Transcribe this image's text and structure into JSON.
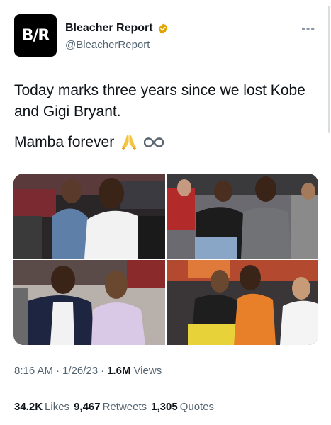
{
  "author": {
    "avatar_text": "B/R",
    "name": "Bleacher Report",
    "handle": "@BleacherReport",
    "verified_color": "#f4b400"
  },
  "menu_icon": "more-horizontal-icon",
  "tweet": {
    "line1": "Today marks three years since we lost Kobe and Gigi Bryant.",
    "line2": "Mamba forever",
    "emojis": [
      "folded-hands-icon",
      "infinity-icon"
    ]
  },
  "media": {
    "photos": [
      {
        "subject": "photo-1"
      },
      {
        "subject": "photo-2"
      },
      {
        "subject": "photo-3"
      },
      {
        "subject": "photo-4"
      }
    ]
  },
  "meta": {
    "time": "8:16 AM",
    "date": "1/26/23",
    "views_count": "1.6M",
    "views_label": "Views",
    "separator": "·"
  },
  "stats": {
    "likes_count": "34.2K",
    "likes_label": "Likes",
    "retweets_count": "9,467",
    "retweets_label": "Retweets",
    "quotes_count": "1,305",
    "quotes_label": "Quotes"
  },
  "colors": {
    "text": "#0f1419",
    "secondary": "#536471",
    "divider": "#eff3f4"
  }
}
